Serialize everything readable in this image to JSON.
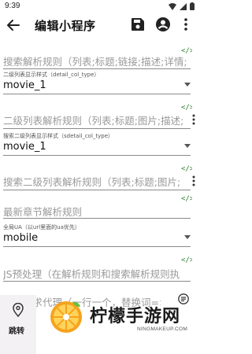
{
  "status_bar": {
    "time": "9:39"
  },
  "app_bar": {
    "title": "编辑小程序",
    "icons": [
      "back-arrow-icon",
      "save-icon",
      "account-icon",
      "more-vert-icon"
    ]
  },
  "form": {
    "search_parse_rule": "搜索解析规则（列表;标题;链接;描述;详情;",
    "detail_col_type": {
      "label": "二级列表显示样式（detail_col_type）",
      "value": "movie_1"
    },
    "detail_list_rule": "二级列表解析规则（列表;标题;图片;描述;",
    "sdetail_col_type": {
      "label": "搜索二级列表显示样式（sdetail_col_type）",
      "value": "movie_1"
    },
    "search_detail_rule": "搜索二级列表解析规则（列表;标题;图片;",
    "latest_chapter_rule": "最新章节解析规则",
    "ua": {
      "label": "全局UA（以url里面的ua优先）",
      "value": "mobile"
    },
    "js_preprocess": "JS预处理（在解析规则和搜索解析规则执",
    "proxy": "网络请求代理（一行一个，替换词=>..."
  },
  "fab": {
    "label": "跳转"
  },
  "watermark": {
    "brand": "柠檬手游网",
    "url": "NINGMAKEUP.COM"
  },
  "colors": {
    "accent": "#2e7d32",
    "hint": "#9a9a9a",
    "fab_bg": "#f3f1f4",
    "logo_orange": "#f6a21e",
    "logo_green": "#6bbf3b"
  }
}
